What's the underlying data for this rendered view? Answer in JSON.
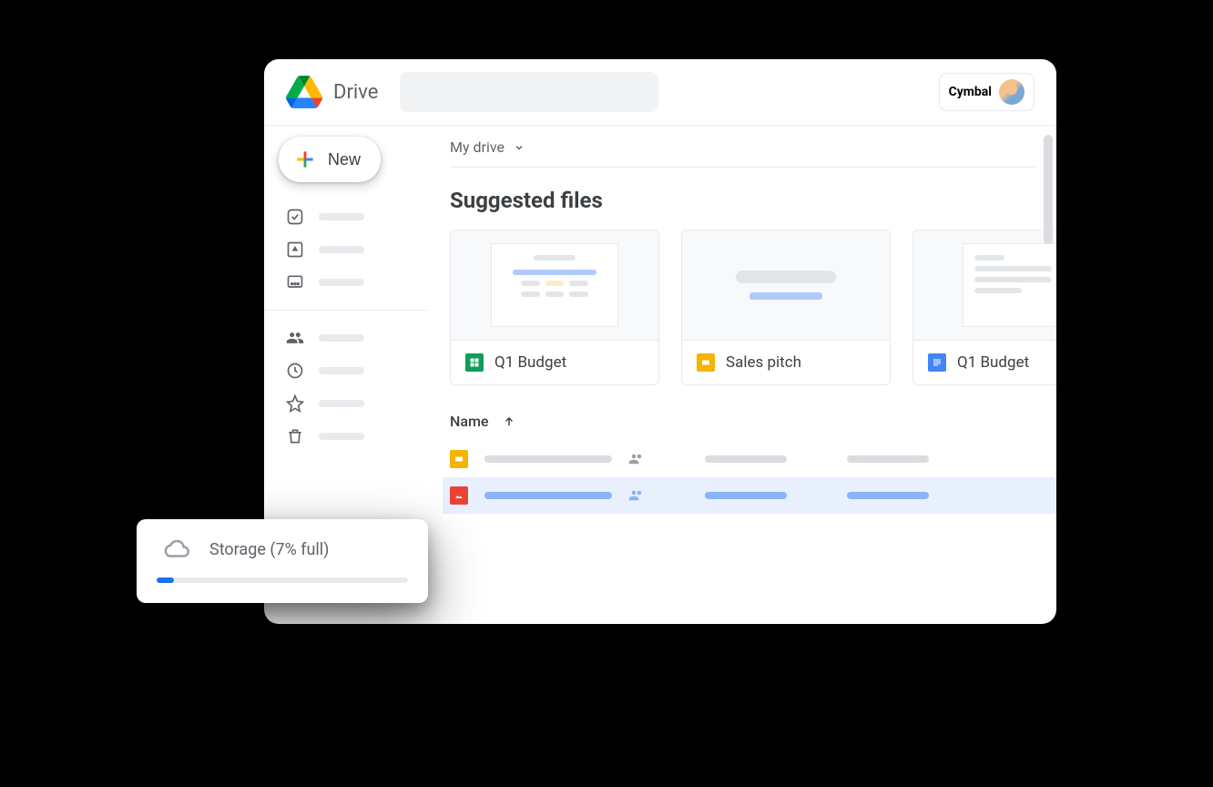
{
  "app": {
    "title": "Drive"
  },
  "account": {
    "label": "Cymbal"
  },
  "sidebar": {
    "new_label": "New"
  },
  "breadcrumb": {
    "label": "My drive"
  },
  "suggested": {
    "title": "Suggested files",
    "cards": [
      {
        "name": "Q1 Budget",
        "type": "sheets"
      },
      {
        "name": "Sales pitch",
        "type": "slides"
      },
      {
        "name": "Q1 Budget",
        "type": "docs"
      }
    ]
  },
  "table": {
    "col_name": "Name"
  },
  "storage": {
    "label": "Storage (7% full)",
    "percent": 7
  }
}
